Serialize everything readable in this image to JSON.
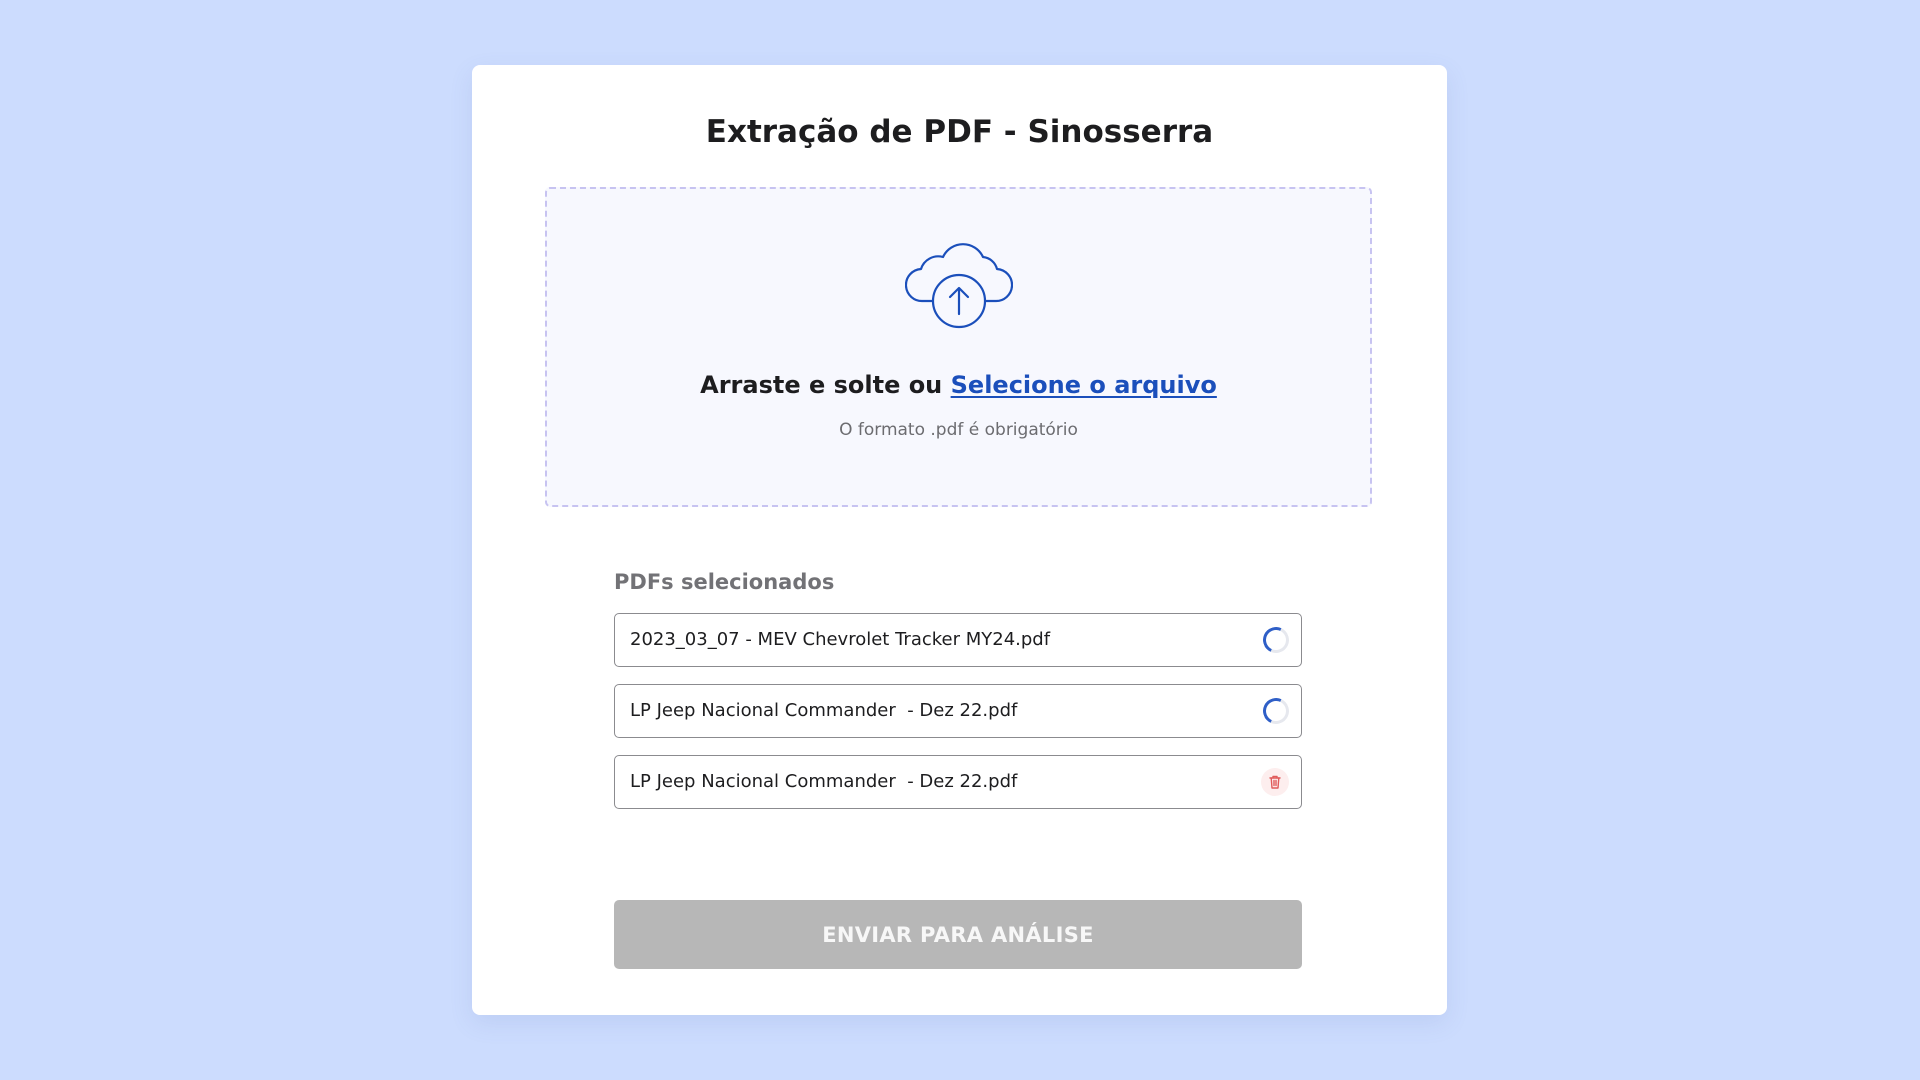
{
  "page": {
    "title": "Extração de PDF - Sinosserra"
  },
  "dropzone": {
    "prompt_text": "Arraste e solte ou ",
    "select_link_label": "Selecione o arquivo",
    "format_hint": "O formato .pdf é obrigatório",
    "icon": "cloud-upload-icon"
  },
  "file_list": {
    "heading": "PDFs selecionados",
    "items": [
      {
        "name": "2023_03_07 - MEV Chevrolet Tracker MY24.pdf",
        "status": "loading",
        "icon": "loading-spinner-icon"
      },
      {
        "name": "LP Jeep Nacional Commander  - Dez 22.pdf",
        "status": "loading",
        "icon": "loading-spinner-icon"
      },
      {
        "name": "LP Jeep Nacional Commander  - Dez 22.pdf",
        "status": "ready",
        "icon": "trash-icon"
      }
    ]
  },
  "submit": {
    "label": "ENVIAR PARA ANÁLISE",
    "disabled": true
  },
  "colors": {
    "page_background": "#ccdcfe",
    "card_background": "#ffffff",
    "accent": "#1b4fbb",
    "dropzone_border": "#c7c3f1",
    "dropzone_background": "#f7f8fe",
    "disabled_button": "#b7b7b7",
    "delete_icon": "#e05a5a"
  }
}
